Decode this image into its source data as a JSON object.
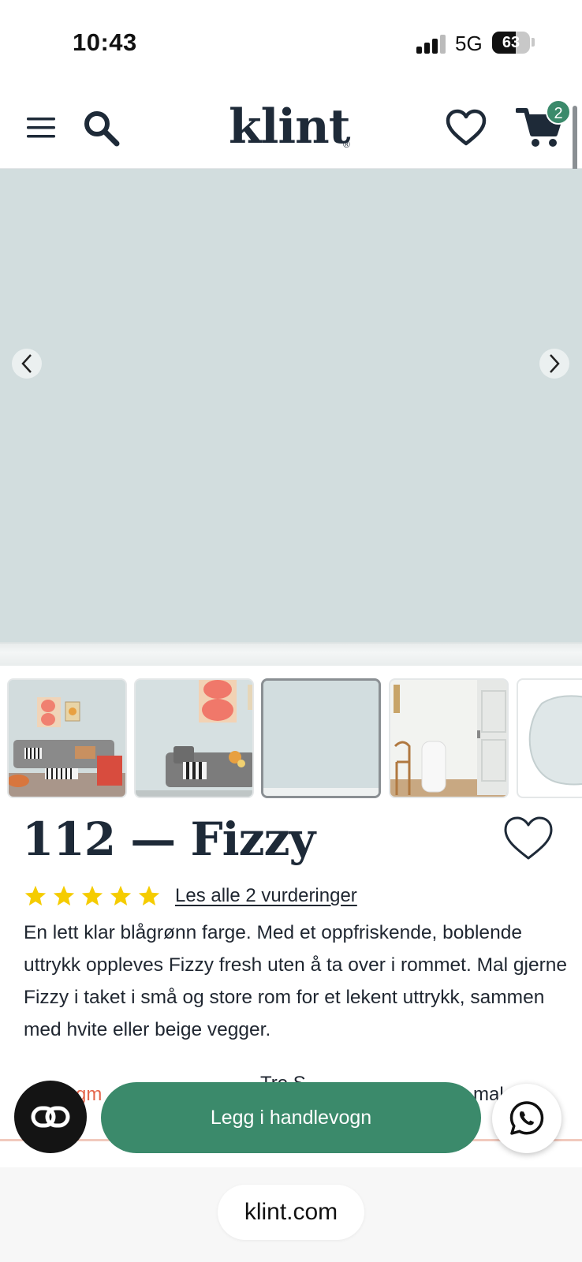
{
  "status_bar": {
    "time": "10:43",
    "network": "5G",
    "battery": "63",
    "battery_level": 0.63
  },
  "header": {
    "logo": "klint",
    "logo_mark": "®",
    "cart_count": "2",
    "icons": [
      "menu-icon",
      "search-icon",
      "heart-icon",
      "cart-icon"
    ]
  },
  "gallery": {
    "hero_color": "#d2ddde",
    "thumbnails": [
      "living-room-orange-art",
      "sofa-pink-art",
      "paint-swatch",
      "hallway-white-chair",
      "paint-blob"
    ],
    "active_index": 2
  },
  "product": {
    "title": "112 — Fizzy",
    "rating": 5,
    "reviews_link": "Les alle 2 vurderinger",
    "description": "En lett klar blågrønn farge. Med et oppfriskende, boblende uttrykk oppleves Fizzy fresh uten å ta over i rommet. Mal gjerne Fizzy i taket i små og store rom for et lekent uttrykk, sammen med hvite eller beige vegger."
  },
  "partial_row": {
    "left": "gm",
    "middle": "Tre   S",
    "right": "mal"
  },
  "actions": {
    "add_to_cart": "Legg i handlevogn"
  },
  "browser": {
    "url": "klint.com"
  },
  "colors": {
    "accent": "#3b8a6b",
    "text": "#1f2630",
    "star": "#f5cc00",
    "hero": "#d2ddde"
  }
}
